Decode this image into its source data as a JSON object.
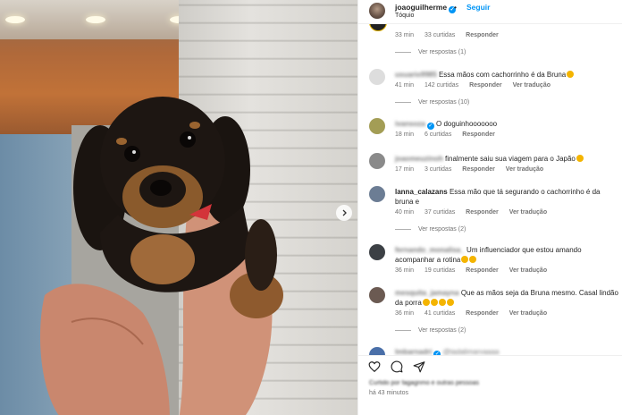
{
  "header": {
    "username": "joaoguilherme",
    "separator": "•",
    "follow_label": "Seguir",
    "location": "Tóquio"
  },
  "comments": [
    {
      "user": "",
      "text": "",
      "time": "33 min",
      "likes": "33 curtidas",
      "reply": "Responder",
      "translate": "",
      "replies": "Ver respostas (1)"
    },
    {
      "user": "usuario9985",
      "text": "Essa mãos com cachorrinho é da Bruna",
      "emoji": true,
      "time": "41 min",
      "likes": "142 curtidas",
      "reply": "Responder",
      "translate": "Ver tradução",
      "replies": "Ver respostas (10)"
    },
    {
      "user": "ivansoza",
      "verified": true,
      "text": "O doguinhooooooo",
      "time": "18 min",
      "likes": "6 curtidas",
      "reply": "Responder",
      "translate": "",
      "replies": ""
    },
    {
      "user": "joaomeuzinoh",
      "text": "finalmente saiu sua viagem para o Japão",
      "emoji": true,
      "time": "17 min",
      "likes": "3 curtidas",
      "reply": "Responder",
      "translate": "Ver tradução",
      "replies": ""
    },
    {
      "user": "lanna_calazans",
      "text": "Essa mão que tá segurando o cachorrinho é da bruna e",
      "time": "40 min",
      "likes": "37 curtidas",
      "reply": "Responder",
      "translate": "Ver tradução",
      "replies": "Ver respostas (2)"
    },
    {
      "user": "fernando_monalisa_",
      "text": "Um influenciador que estou amando acompanhar a rotina",
      "emoji": true,
      "time": "36 min",
      "likes": "19 curtidas",
      "reply": "Responder",
      "translate": "Ver tradução",
      "replies": ""
    },
    {
      "user": "mesquita_jamayna",
      "text": "Que as mãos seja da Bruna mesmo. Casal lindão da porra",
      "emoji": true,
      "time": "36 min",
      "likes": "41 curtidas",
      "reply": "Responder",
      "translate": "Ver tradução",
      "replies": "Ver respostas (2)"
    },
    {
      "user": "lmbarnadri",
      "verified": true,
      "text": "@tadalimarvaaaa",
      "time": "",
      "likes": "",
      "reply": "",
      "translate": "",
      "replies": ""
    }
  ],
  "footer": {
    "likes_text": "Curtido por fagagnmo e outras pessoas",
    "time_ago": "há 43 minutos"
  },
  "icons": [
    "heart-icon",
    "comment-icon",
    "share-icon",
    "next-arrow-icon",
    "verified-icon"
  ],
  "colors": {
    "accent": "#0095f6",
    "text": "#262626",
    "muted": "#737373"
  }
}
